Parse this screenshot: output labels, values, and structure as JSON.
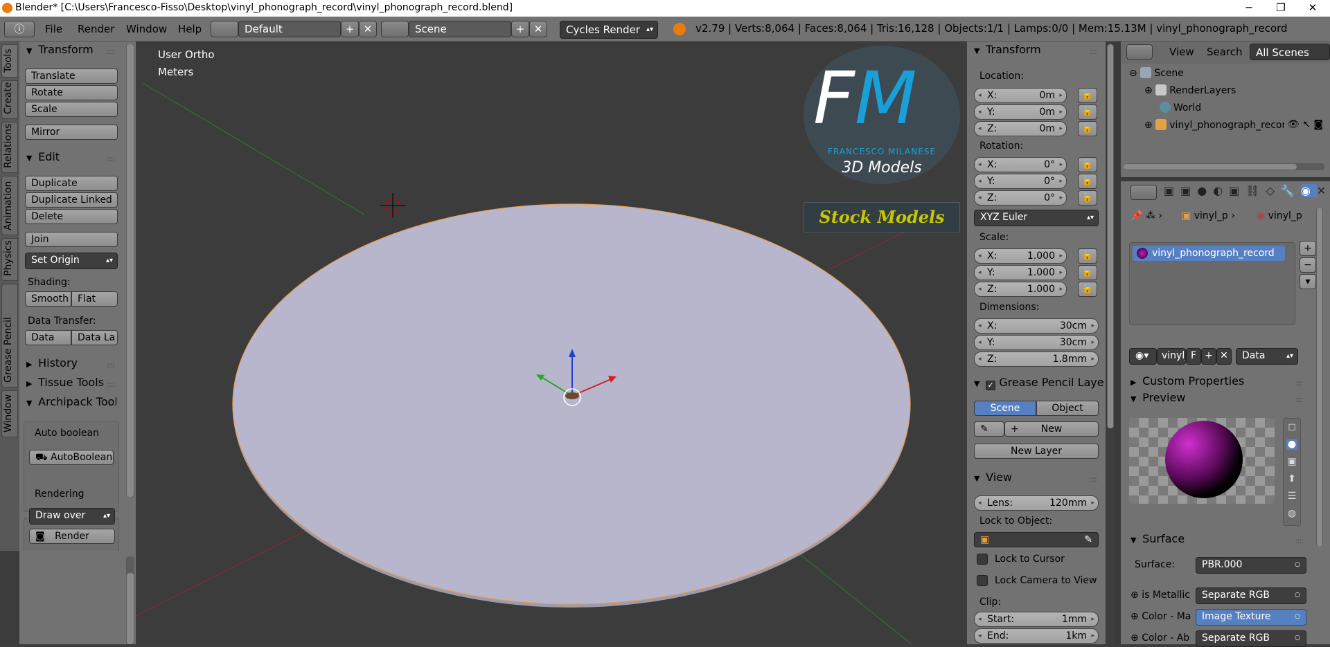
{
  "window": {
    "title": "Blender* [C:\\Users\\Francesco-Fisso\\Desktop\\vinyl_phonograph_record\\vinyl_phonograph_record.blend]",
    "minimize": "─",
    "maximize": "❐",
    "close": "✕"
  },
  "menubar": {
    "info_icon": "ⓘ",
    "menus": [
      "File",
      "Render",
      "Window",
      "Help"
    ],
    "layout": "Default",
    "scene": "Scene",
    "engine": "Cycles Render",
    "stats": "v2.79 | Verts:8,064 | Faces:8,064 | Tris:16,128 | Objects:1/1 | Lamps:0/0 | Mem:15.13M | vinyl_phonograph_record"
  },
  "tabs": [
    "Tools",
    "Create",
    "Relations",
    "Animation",
    "Physics",
    "Grease Pencil",
    "Window"
  ],
  "tools": {
    "transform_title": "Transform",
    "translate": "Translate",
    "rotate": "Rotate",
    "scale": "Scale",
    "mirror": "Mirror",
    "edit_title": "Edit",
    "duplicate": "Duplicate",
    "duplicate_linked": "Duplicate Linked",
    "delete": "Delete",
    "join": "Join",
    "set_origin": "Set Origin",
    "shading_label": "Shading:",
    "smooth": "Smooth",
    "flat": "Flat",
    "data_transfer_label": "Data Transfer:",
    "data": "Data",
    "data_la": "Data La",
    "history": "History",
    "tissue_tools": "Tissue Tools",
    "archipack": "Archipack Tools",
    "auto_boolean_label": "Auto boolean",
    "autoboolean_btn": "AutoBoolean",
    "rendering_label": "Rendering",
    "draw_over": "Draw over",
    "render_btn": "Render"
  },
  "viewport": {
    "view_name": "User Ortho",
    "units": "Meters",
    "watermark_initials": "FM",
    "watermark_name": "FRANCESCO MILANESE",
    "watermark_sub": "3D Models",
    "watermark_banner": "Stock Models"
  },
  "properties_n": {
    "transform_title": "Transform",
    "location_label": "Location:",
    "location": [
      {
        "axis": "X:",
        "value": "0m"
      },
      {
        "axis": "Y:",
        "value": "0m"
      },
      {
        "axis": "Z:",
        "value": "0m"
      }
    ],
    "rotation_label": "Rotation:",
    "rotation": [
      {
        "axis": "X:",
        "value": "0°"
      },
      {
        "axis": "Y:",
        "value": "0°"
      },
      {
        "axis": "Z:",
        "value": "0°"
      }
    ],
    "euler_mode": "XYZ Euler",
    "scale_label": "Scale:",
    "scale": [
      {
        "axis": "X:",
        "value": "1.000"
      },
      {
        "axis": "Y:",
        "value": "1.000"
      },
      {
        "axis": "Z:",
        "value": "1.000"
      }
    ],
    "dimensions_label": "Dimensions:",
    "dimensions": [
      {
        "axis": "X:",
        "value": "30cm"
      },
      {
        "axis": "Y:",
        "value": "30cm"
      },
      {
        "axis": "Z:",
        "value": "1.8mm"
      }
    ],
    "grease_pencil_title": "Grease Pencil Layers",
    "gp_scene": "Scene",
    "gp_object": "Object",
    "gp_new": "New",
    "gp_new_layer": "New Layer",
    "view_title": "View",
    "lens_label": "Lens:",
    "lens_value": "120mm",
    "lock_to_object_label": "Lock to Object:",
    "lock_to_cursor": "Lock to Cursor",
    "lock_camera": "Lock Camera to View",
    "clip_label": "Clip:",
    "clip_start_label": "Start:",
    "clip_start": "1mm",
    "clip_end_label": "End:",
    "clip_end": "1km"
  },
  "outliner": {
    "view_menu": "View",
    "search_menu": "Search",
    "filter": "All Scenes",
    "items": [
      "Scene",
      "RenderLayers",
      "World",
      "vinyl_phonograph_record"
    ]
  },
  "properties": {
    "breadcrumb_1": "vinyl_p",
    "breadcrumb_2": "vinyl_p",
    "material_slot": "vinyl_phonograph_record",
    "material_name": "vinyl_",
    "fake_user": "F",
    "link_mode": "Data",
    "custom_props": "Custom Properties",
    "preview_title": "Preview",
    "surface_title": "Surface",
    "surface_label": "Surface:",
    "surface_value": "PBR.000",
    "sockets": [
      {
        "label": "is Metallic",
        "value": "Separate RGB"
      },
      {
        "label": "Color - Ma",
        "value": "Image Texture"
      },
      {
        "label": "Color - Ab",
        "value": "Separate RGB"
      }
    ]
  },
  "colors": {
    "ui_gray": "#727272",
    "viewport_bg": "#3c3c3c",
    "disc_face": "#b8b6cc",
    "selection_outline": "#e8a050",
    "active_blue": "#5680c2",
    "watermark_blue": "#1aa0d8",
    "watermark_yellow": "#c8c800"
  }
}
